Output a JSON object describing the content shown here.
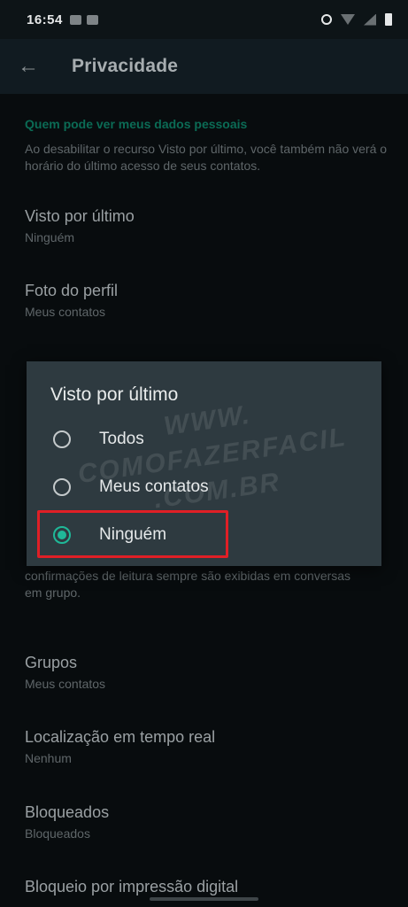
{
  "status": {
    "time": "16:54"
  },
  "header": {
    "title": "Privacidade"
  },
  "section": {
    "heading": "Quem pode ver meus dados pessoais",
    "description": "Ao desabilitar o recurso Visto por último, você também não verá o horário do último acesso de seus contatos."
  },
  "items": [
    {
      "title": "Visto por último",
      "value": "Ninguém"
    },
    {
      "title": "Foto do perfil",
      "value": "Meus contatos"
    },
    {
      "title": "Grupos",
      "value": "Meus contatos"
    },
    {
      "title": "Localização em tempo real",
      "value": "Nenhum"
    },
    {
      "title": "Bloqueados",
      "value": "Bloqueados"
    },
    {
      "title": "Bloqueio por impressão digital",
      "value": ""
    }
  ],
  "read_receipts_note": "confirmações de leitura sempre são exibidas em conversas em grupo.",
  "dialog": {
    "title": "Visto por último",
    "options": [
      "Todos",
      "Meus contatos",
      "Ninguém"
    ],
    "selected": "Ninguém"
  },
  "watermark": "WWW. COMOFAZERFACIL .COM.BR",
  "colors": {
    "accent": "#1fb898",
    "highlight": "#e01f26",
    "dialog_bg": "#2e3a40"
  }
}
